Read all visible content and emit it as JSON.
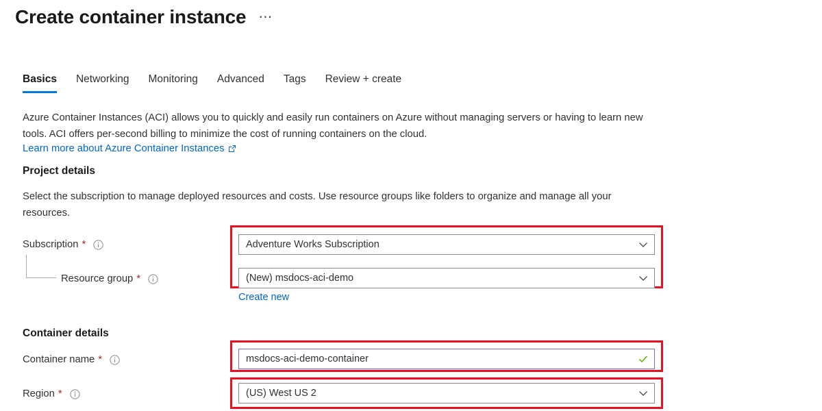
{
  "header": {
    "title": "Create container instance",
    "more_menu_label": "⋯"
  },
  "tabs": [
    {
      "label": "Basics",
      "active": true
    },
    {
      "label": "Networking",
      "active": false
    },
    {
      "label": "Monitoring",
      "active": false
    },
    {
      "label": "Advanced",
      "active": false
    },
    {
      "label": "Tags",
      "active": false
    },
    {
      "label": "Review + create",
      "active": false
    }
  ],
  "intro": {
    "text": "Azure Container Instances (ACI) allows you to quickly and easily run containers on Azure without managing servers or having to learn new tools. ACI offers per-second billing to minimize the cost of running containers on the cloud.",
    "link_text": "Learn more about Azure Container Instances"
  },
  "project_details": {
    "heading": "Project details",
    "description": "Select the subscription to manage deployed resources and costs. Use resource groups like folders to organize and manage all your resources.",
    "subscription": {
      "label": "Subscription",
      "required_marker": "*",
      "value": "Adventure Works Subscription"
    },
    "resource_group": {
      "label": "Resource group",
      "required_marker": "*",
      "value": "(New) msdocs-aci-demo",
      "create_new_label": "Create new"
    }
  },
  "container_details": {
    "heading": "Container details",
    "container_name": {
      "label": "Container name",
      "required_marker": "*",
      "value": "msdocs-aci-demo-container"
    },
    "region": {
      "label": "Region",
      "required_marker": "*",
      "value": "(US) West US 2"
    }
  },
  "colors": {
    "accent": "#0078d4",
    "link": "#0066cc",
    "highlight": "#e81123",
    "required": "#a4262c",
    "validated_border": "#8764b8",
    "success": "#5db300"
  }
}
